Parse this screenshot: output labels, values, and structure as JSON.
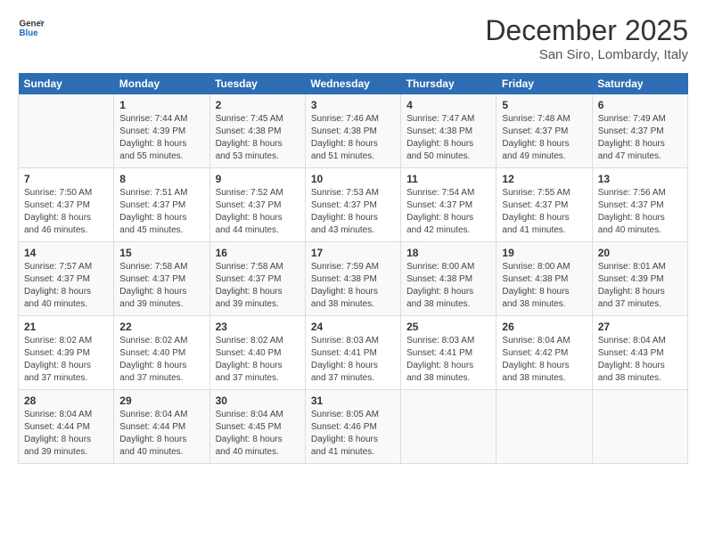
{
  "header": {
    "logo_line1": "General",
    "logo_line2": "Blue",
    "month": "December 2025",
    "location": "San Siro, Lombardy, Italy"
  },
  "days_of_week": [
    "Sunday",
    "Monday",
    "Tuesday",
    "Wednesday",
    "Thursday",
    "Friday",
    "Saturday"
  ],
  "weeks": [
    [
      {
        "day": "",
        "info": ""
      },
      {
        "day": "1",
        "info": "Sunrise: 7:44 AM\nSunset: 4:39 PM\nDaylight: 8 hours\nand 55 minutes."
      },
      {
        "day": "2",
        "info": "Sunrise: 7:45 AM\nSunset: 4:38 PM\nDaylight: 8 hours\nand 53 minutes."
      },
      {
        "day": "3",
        "info": "Sunrise: 7:46 AM\nSunset: 4:38 PM\nDaylight: 8 hours\nand 51 minutes."
      },
      {
        "day": "4",
        "info": "Sunrise: 7:47 AM\nSunset: 4:38 PM\nDaylight: 8 hours\nand 50 minutes."
      },
      {
        "day": "5",
        "info": "Sunrise: 7:48 AM\nSunset: 4:37 PM\nDaylight: 8 hours\nand 49 minutes."
      },
      {
        "day": "6",
        "info": "Sunrise: 7:49 AM\nSunset: 4:37 PM\nDaylight: 8 hours\nand 47 minutes."
      }
    ],
    [
      {
        "day": "7",
        "info": "Sunrise: 7:50 AM\nSunset: 4:37 PM\nDaylight: 8 hours\nand 46 minutes."
      },
      {
        "day": "8",
        "info": "Sunrise: 7:51 AM\nSunset: 4:37 PM\nDaylight: 8 hours\nand 45 minutes."
      },
      {
        "day": "9",
        "info": "Sunrise: 7:52 AM\nSunset: 4:37 PM\nDaylight: 8 hours\nand 44 minutes."
      },
      {
        "day": "10",
        "info": "Sunrise: 7:53 AM\nSunset: 4:37 PM\nDaylight: 8 hours\nand 43 minutes."
      },
      {
        "day": "11",
        "info": "Sunrise: 7:54 AM\nSunset: 4:37 PM\nDaylight: 8 hours\nand 42 minutes."
      },
      {
        "day": "12",
        "info": "Sunrise: 7:55 AM\nSunset: 4:37 PM\nDaylight: 8 hours\nand 41 minutes."
      },
      {
        "day": "13",
        "info": "Sunrise: 7:56 AM\nSunset: 4:37 PM\nDaylight: 8 hours\nand 40 minutes."
      }
    ],
    [
      {
        "day": "14",
        "info": "Sunrise: 7:57 AM\nSunset: 4:37 PM\nDaylight: 8 hours\nand 40 minutes."
      },
      {
        "day": "15",
        "info": "Sunrise: 7:58 AM\nSunset: 4:37 PM\nDaylight: 8 hours\nand 39 minutes."
      },
      {
        "day": "16",
        "info": "Sunrise: 7:58 AM\nSunset: 4:37 PM\nDaylight: 8 hours\nand 39 minutes."
      },
      {
        "day": "17",
        "info": "Sunrise: 7:59 AM\nSunset: 4:38 PM\nDaylight: 8 hours\nand 38 minutes."
      },
      {
        "day": "18",
        "info": "Sunrise: 8:00 AM\nSunset: 4:38 PM\nDaylight: 8 hours\nand 38 minutes."
      },
      {
        "day": "19",
        "info": "Sunrise: 8:00 AM\nSunset: 4:38 PM\nDaylight: 8 hours\nand 38 minutes."
      },
      {
        "day": "20",
        "info": "Sunrise: 8:01 AM\nSunset: 4:39 PM\nDaylight: 8 hours\nand 37 minutes."
      }
    ],
    [
      {
        "day": "21",
        "info": "Sunrise: 8:02 AM\nSunset: 4:39 PM\nDaylight: 8 hours\nand 37 minutes."
      },
      {
        "day": "22",
        "info": "Sunrise: 8:02 AM\nSunset: 4:40 PM\nDaylight: 8 hours\nand 37 minutes."
      },
      {
        "day": "23",
        "info": "Sunrise: 8:02 AM\nSunset: 4:40 PM\nDaylight: 8 hours\nand 37 minutes."
      },
      {
        "day": "24",
        "info": "Sunrise: 8:03 AM\nSunset: 4:41 PM\nDaylight: 8 hours\nand 37 minutes."
      },
      {
        "day": "25",
        "info": "Sunrise: 8:03 AM\nSunset: 4:41 PM\nDaylight: 8 hours\nand 38 minutes."
      },
      {
        "day": "26",
        "info": "Sunrise: 8:04 AM\nSunset: 4:42 PM\nDaylight: 8 hours\nand 38 minutes."
      },
      {
        "day": "27",
        "info": "Sunrise: 8:04 AM\nSunset: 4:43 PM\nDaylight: 8 hours\nand 38 minutes."
      }
    ],
    [
      {
        "day": "28",
        "info": "Sunrise: 8:04 AM\nSunset: 4:44 PM\nDaylight: 8 hours\nand 39 minutes."
      },
      {
        "day": "29",
        "info": "Sunrise: 8:04 AM\nSunset: 4:44 PM\nDaylight: 8 hours\nand 40 minutes."
      },
      {
        "day": "30",
        "info": "Sunrise: 8:04 AM\nSunset: 4:45 PM\nDaylight: 8 hours\nand 40 minutes."
      },
      {
        "day": "31",
        "info": "Sunrise: 8:05 AM\nSunset: 4:46 PM\nDaylight: 8 hours\nand 41 minutes."
      },
      {
        "day": "",
        "info": ""
      },
      {
        "day": "",
        "info": ""
      },
      {
        "day": "",
        "info": ""
      }
    ]
  ]
}
